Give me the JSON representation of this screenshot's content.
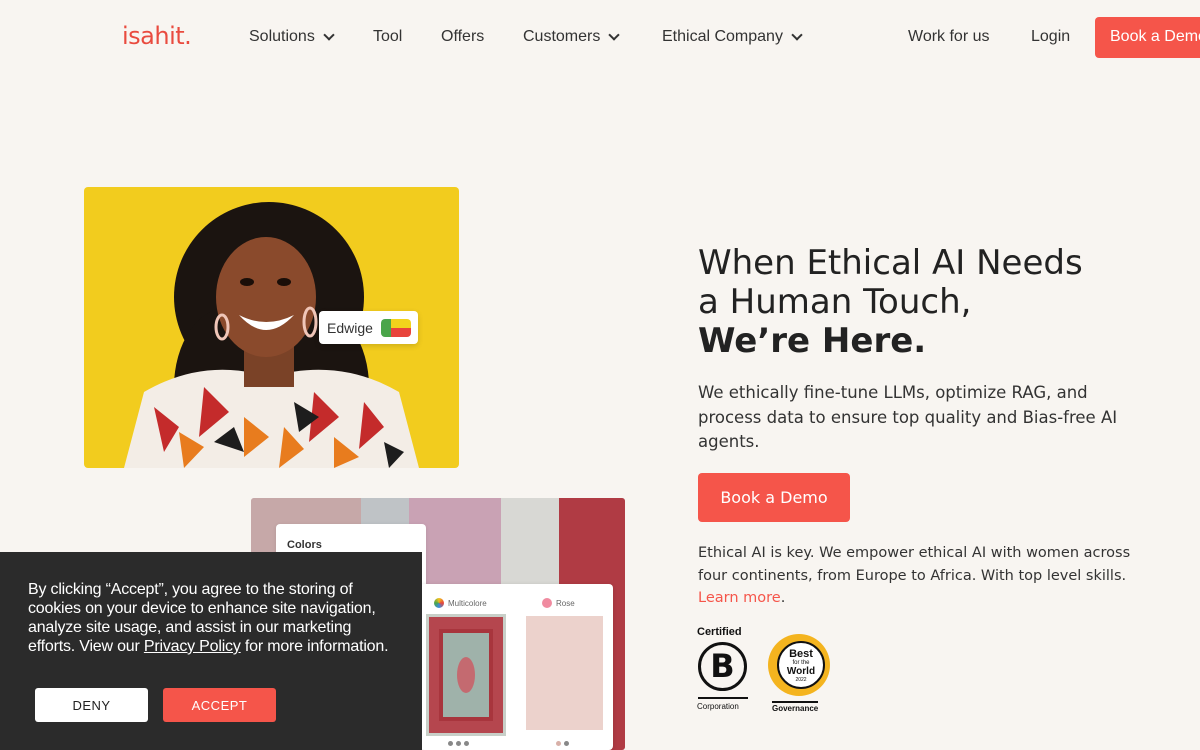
{
  "brand": {
    "logo": "isahit.",
    "accent": "#f5554a"
  },
  "nav": {
    "items": [
      {
        "label": "Solutions",
        "dropdown": true
      },
      {
        "label": "Tool",
        "dropdown": false
      },
      {
        "label": "Offers",
        "dropdown": false
      },
      {
        "label": "Customers",
        "dropdown": true
      },
      {
        "label": "Ethical Company",
        "dropdown": true
      },
      {
        "label": "Work for us",
        "dropdown": false
      },
      {
        "label": "Login",
        "dropdown": false
      }
    ],
    "cta": "Book a Demo"
  },
  "hero": {
    "name_tag": "Edwige",
    "headline_line1": "When Ethical AI Needs",
    "headline_line2": "a Human Touch,",
    "headline_bold": "We’re Here.",
    "subcopy": "We ethically fine-tune LLMs, optimize RAG, and process data to ensure top quality and Bias-free AI agents.",
    "cta": "Book a Demo",
    "body": "Ethical AI is key. We empower ethical AI with women across four continents, from Europe to Africa. With top level skills.",
    "learn_more": "Learn more",
    "period": "."
  },
  "mockup": {
    "colors_title": "Colors",
    "swatch1": "Multicolore",
    "swatch2": "Rose"
  },
  "badges": {
    "bcorp_top": "Certified",
    "bcorp_letter": "B",
    "bcorp_bottom": "Corporation",
    "bftw_best": "Best",
    "bftw_for": "for the",
    "bftw_world": "World",
    "bftw_year": "2022",
    "bftw_label": "Governance"
  },
  "cookie": {
    "text_before": "By clicking “Accept”, you agree to the storing of cookies on your device to enhance site navigation, analyze site usage, and assist in our marketing efforts. View our ",
    "link": "Privacy Policy",
    "text_after": " for more information.",
    "deny": "DENY",
    "accept": "ACCEPT"
  }
}
